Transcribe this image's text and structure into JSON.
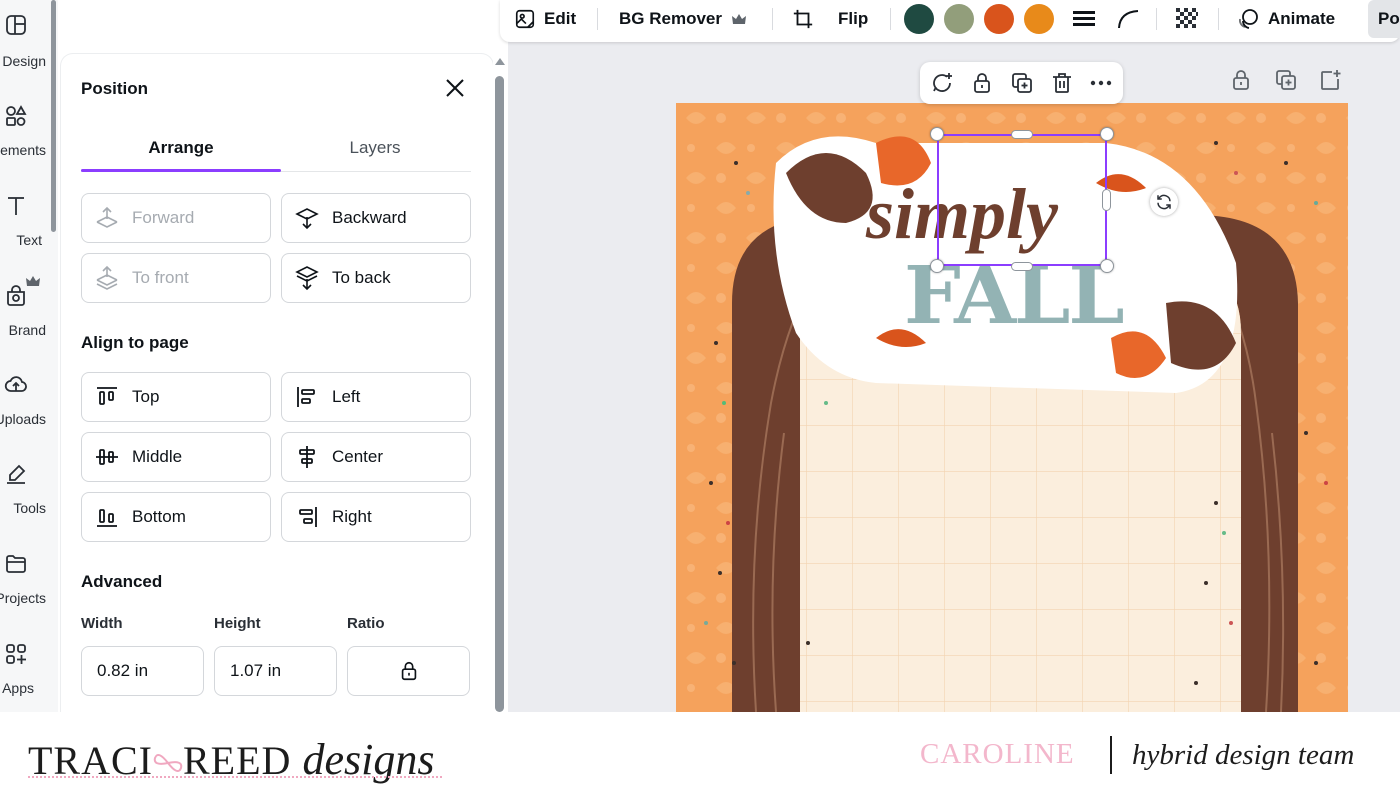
{
  "sidebar": {
    "items": [
      {
        "label": "Design",
        "icon": "design-icon"
      },
      {
        "label": "Elements",
        "icon": "elements-icon"
      },
      {
        "label": "Text",
        "icon": "text-icon"
      },
      {
        "label": "Brand",
        "icon": "brand-icon"
      },
      {
        "label": "Uploads",
        "icon": "uploads-icon"
      },
      {
        "label": "Tools",
        "icon": "tools-icon"
      },
      {
        "label": "Projects",
        "icon": "projects-icon"
      },
      {
        "label": "Apps",
        "icon": "apps-icon"
      }
    ]
  },
  "panel": {
    "title": "Position",
    "tabs": {
      "arrange": "Arrange",
      "layers": "Layers"
    },
    "order_buttons": {
      "forward": "Forward",
      "backward": "Backward",
      "to_front": "To front",
      "to_back": "To back"
    },
    "align_section": "Align to page",
    "align_buttons": {
      "top": "Top",
      "left": "Left",
      "middle": "Middle",
      "center": "Center",
      "bottom": "Bottom",
      "right": "Right"
    },
    "advanced_section": "Advanced",
    "fields": {
      "width_label": "Width",
      "width_value": "0.82 in",
      "height_label": "Height",
      "height_value": "1.07 in",
      "ratio_label": "Ratio"
    }
  },
  "toolbar": {
    "edit": "Edit",
    "bg_remover": "BG Remover",
    "flip": "Flip",
    "animate": "Animate",
    "position": "Position",
    "swatches": [
      "#1f4a41",
      "#929e7b",
      "#d9541c",
      "#e88a1a"
    ]
  },
  "canvas": {
    "title_script": "simply",
    "title_bold": "FALL"
  },
  "footer": {
    "brand_left_1": "TRACI",
    "brand_left_2": "REED",
    "brand_left_script": "designs",
    "name": "CAROLINE",
    "team": "hybrid design team"
  },
  "colors": {
    "accent": "#8b3dff",
    "orange_bg": "#f5a25c",
    "brown": "#6e3f2e",
    "cream": "#fbeedd",
    "pink": "#f3b7cc"
  }
}
